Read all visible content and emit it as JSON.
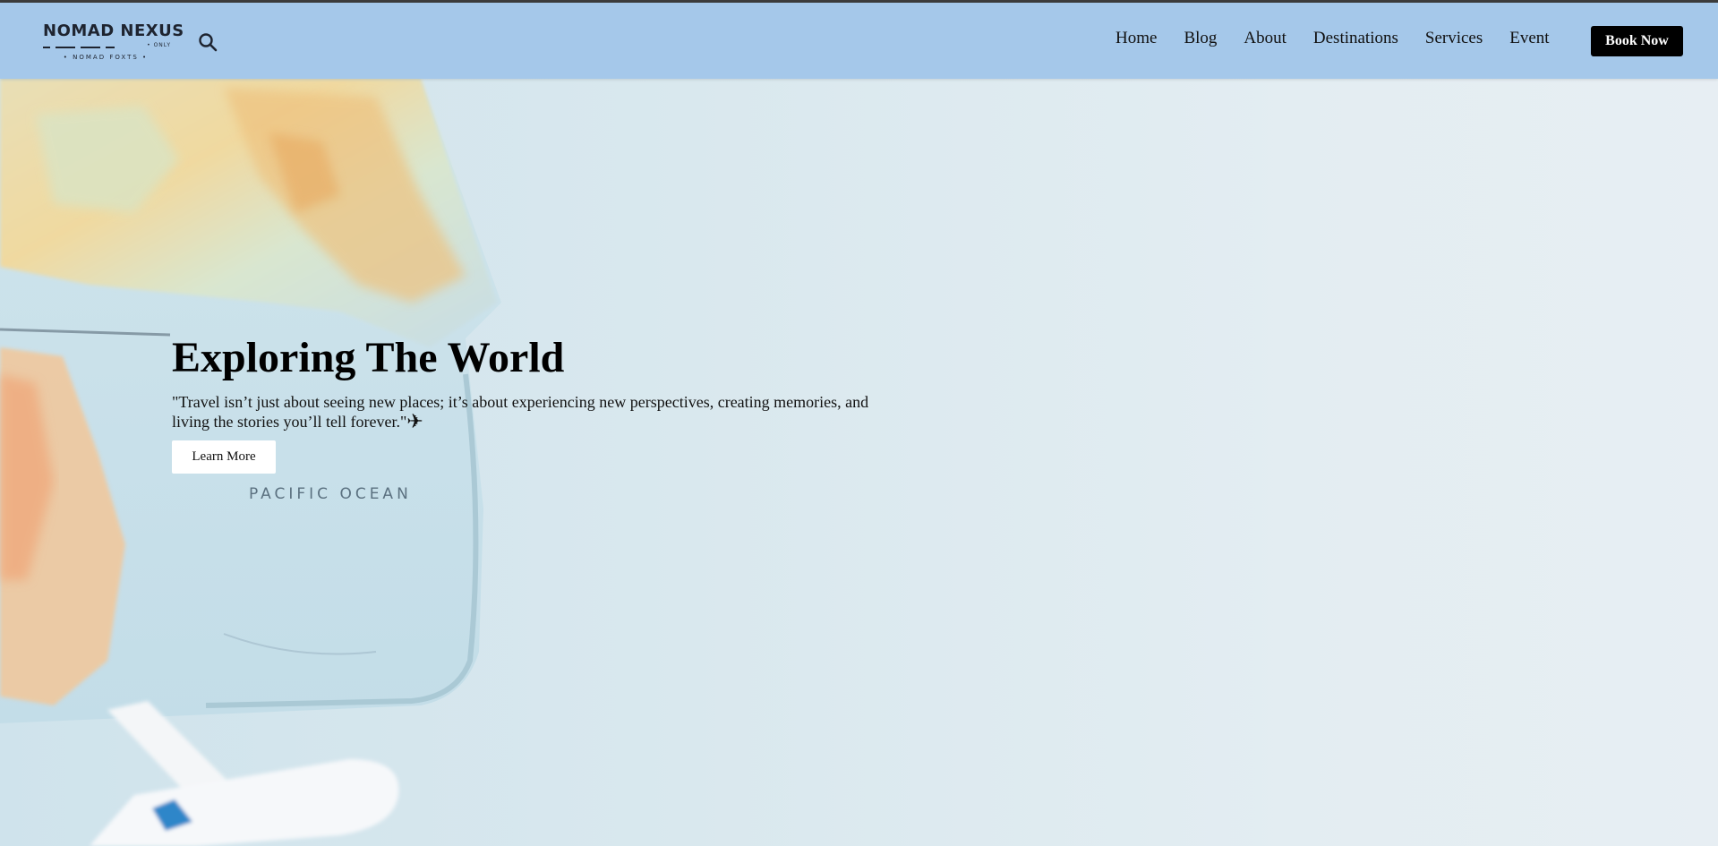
{
  "brand": {
    "name": "NOMAD NEXUS",
    "tag": "• ONLY",
    "sub": "• NOMAD   FOXTS •"
  },
  "header": {
    "search_icon": "search-icon",
    "nav": [
      "Home",
      "Blog",
      "About",
      "Destinations",
      "Services",
      "Event"
    ],
    "cta_label": "Book Now"
  },
  "hero": {
    "title": "Exploring The World",
    "quote": "\"Travel isn’t just about seeing new places; it’s about experiencing new perspectives, creating memories, and living the stories you’ll tell forever.\"",
    "quote_icon": "airplane-icon",
    "button_label": "Learn More",
    "map_label": "PACIFIC OCEAN"
  },
  "colors": {
    "navbar_bg": "#a5c8ea",
    "cta_bg": "#000000",
    "hero_bg": "#dce9ef"
  }
}
